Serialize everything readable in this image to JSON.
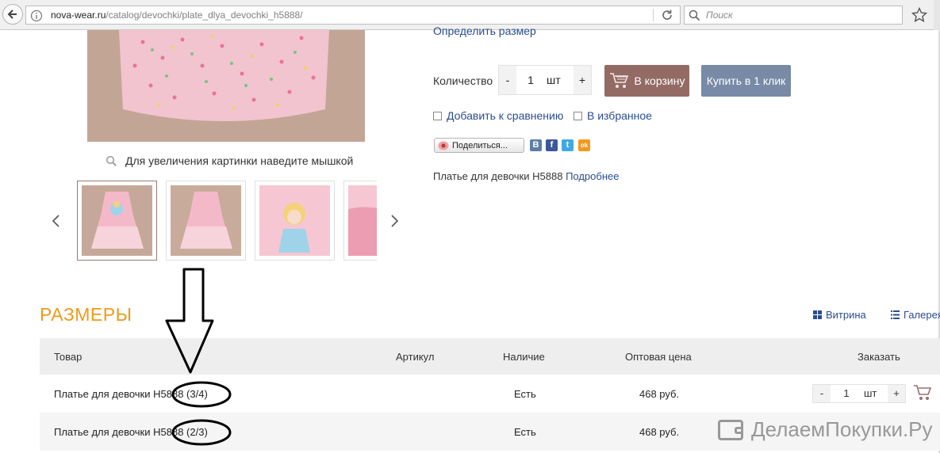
{
  "browser": {
    "url_host": "nova-wear.ru",
    "url_path": "/catalog/devochki/plate_dlya_devochki_h5888/",
    "search_placeholder": "Поиск"
  },
  "product": {
    "size_link": "Определить размер",
    "zoom_hint": "Для увеличения картинки наведите мышкой",
    "quantity_label": "Количество",
    "quantity": {
      "minus": "-",
      "value": "1",
      "unit": "шт",
      "plus": "+"
    },
    "cart_button": "В корзину",
    "buy_one_click": "Купить в 1 клик",
    "compare": "Добавить к сравнению",
    "favorite": "В избранное",
    "share": "Поделиться...",
    "social": [
      "В",
      "f",
      "t",
      "ok"
    ],
    "description": "Платье для девочки H5888",
    "more_link": "Подробнее"
  },
  "sizes": {
    "title": "РАЗМЕРЫ",
    "view_vitrina": "Витрина",
    "view_gallery": "Галерея",
    "columns": [
      "Товар",
      "Артикул",
      "Наличие",
      "Оптовая цена",
      "Заказать"
    ],
    "rows": [
      {
        "name": "Платье для девочки H5888 (3/4)",
        "sku": "",
        "stock": "Есть",
        "price": "468 руб.",
        "qty": "1",
        "unit": "шт",
        "minus": "-",
        "plus": "+"
      },
      {
        "name": "Платье для девочки H5888 (2/3)",
        "sku": "",
        "stock": "Есть",
        "price": "468 руб."
      }
    ]
  },
  "watermark": "ДелаемПокупки.Ру",
  "colors": {
    "accent_orange": "#ef9a1a",
    "cart_brown": "#936b64",
    "buy_blue": "#788aa6",
    "link_blue": "#2a4d8f"
  }
}
